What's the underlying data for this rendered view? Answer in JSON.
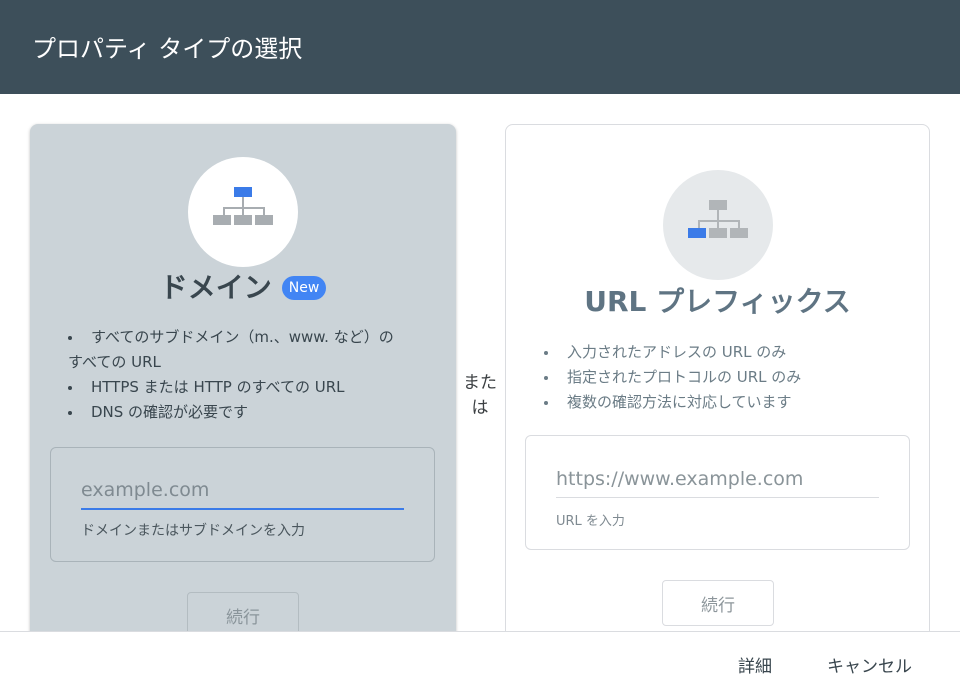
{
  "dialog": {
    "title": "プロパティ タイプの選択"
  },
  "domain_card": {
    "title": "ドメイン",
    "badge": "New",
    "bullets": [
      {
        "line1": "すべてのサブドメイン（m.、www. など）の",
        "line2": "すべての URL"
      },
      {
        "line1": "HTTPS または HTTP のすべての URL"
      },
      {
        "line1": "DNS の確認が必要です"
      }
    ],
    "input_placeholder": "example.com",
    "input_value": "",
    "hint": "ドメインまたはサブドメインを入力",
    "continue_label": "続行",
    "colors": {
      "icon_accent": "#3b7be8",
      "icon_gray": "#a8adb1"
    }
  },
  "or_label": "または",
  "url_card": {
    "title": "URL プレフィックス",
    "bullets": [
      "入力されたアドレスの URL のみ",
      "指定されたプロトコルの URL のみ",
      "複数の確認方法に対応しています"
    ],
    "input_placeholder": "https://www.example.com",
    "input_value": "",
    "hint": "URL を入力",
    "continue_label": "続行",
    "colors": {
      "icon_accent": "#3b7be8",
      "icon_gray": "#b1b5b8"
    }
  },
  "footer": {
    "details_label": "詳細",
    "cancel_label": "キャンセル"
  },
  "colors": {
    "header_bg": "#3d4f5a",
    "accent_blue": "#4285f4",
    "domain_card_bg": "#cbd3d8"
  },
  "icons": {
    "domain": "sitemap-top-highlight-icon",
    "url_prefix": "sitemap-bottom-left-highlight-icon"
  }
}
